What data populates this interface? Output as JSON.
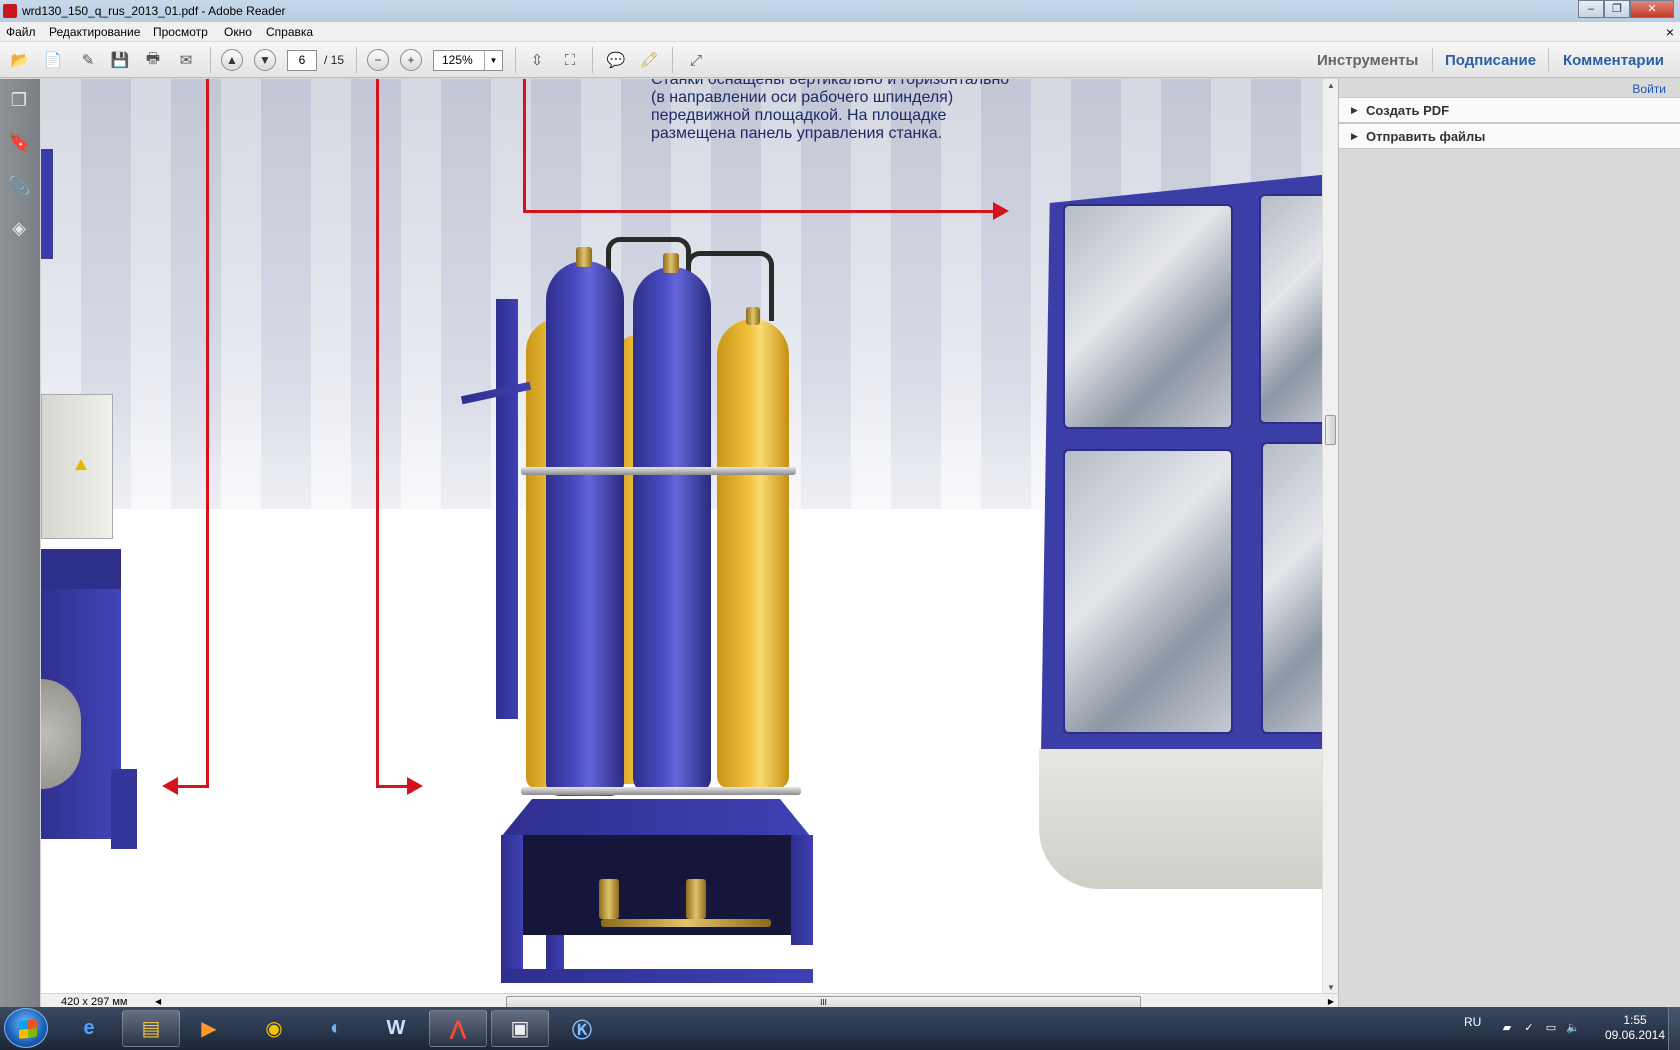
{
  "window": {
    "title": "wrd130_150_q_rus_2013_01.pdf - Adobe Reader",
    "minimize": "–",
    "maximize": "❐",
    "close": "✕"
  },
  "menu": {
    "items": [
      "Файл",
      "Редактирование",
      "Просмотр",
      "Окно",
      "Справка"
    ],
    "doc_close": "×"
  },
  "toolbar": {
    "page_current": "6",
    "page_total": "/ 15",
    "zoom": "125%",
    "zoom_drop": "▼",
    "tabs": {
      "tools": "Инструменты",
      "sign": "Подписание",
      "comment": "Комментарии"
    }
  },
  "document": {
    "caption_lines": [
      "Станки оснащены вертикально и горизонтально",
      "(в направлении оси рабочего шпинделя)",
      "передвижной площадкой. На площадке",
      "размещена панель управления  станка."
    ]
  },
  "status": {
    "page_size": "420 x 297 мм",
    "hscroll_grip": "III"
  },
  "right_panel": {
    "login": "Войти",
    "sections": [
      "Создать PDF",
      "Отправить файлы"
    ]
  },
  "taskbar": {
    "lang": "RU",
    "time": "1:55",
    "date": "09.06.2014"
  },
  "colors": {
    "accent_red": "#d6121c",
    "caption_blue": "#1d2a66",
    "link_blue": "#1a55b0"
  }
}
